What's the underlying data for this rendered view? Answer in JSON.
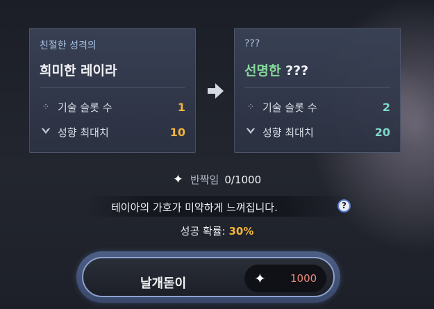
{
  "left_card": {
    "subtitle": "친절한 성격의",
    "name": "희미한 레이라",
    "stats": [
      {
        "icon": "sparkle-dots-icon",
        "label": "기술 슬롯 수",
        "value": "1"
      },
      {
        "icon": "leaf-icon",
        "label": "성향 최대치",
        "value": "10"
      }
    ]
  },
  "right_card": {
    "subtitle": "???",
    "name_accent": "선명한",
    "name_rest": "???",
    "stats": [
      {
        "icon": "sparkle-dots-icon",
        "label": "기술 슬롯 수",
        "value": "2"
      },
      {
        "icon": "leaf-icon",
        "label": "성향 최대치",
        "value": "20"
      }
    ]
  },
  "sparkle": {
    "label": "반짝임",
    "count": "0/1000"
  },
  "blessing_text": "테이아의 가호가 미약하게 느껴집니다.",
  "help_label": "?",
  "success": {
    "label": "성공 확률:",
    "value": "30%"
  },
  "action_button": {
    "label": "날개돋이",
    "cost": "1000"
  },
  "colors": {
    "gold": "#f2b53d",
    "teal": "#7fd8cd",
    "green": "#86d99a",
    "cost_red": "#f08a7a"
  }
}
